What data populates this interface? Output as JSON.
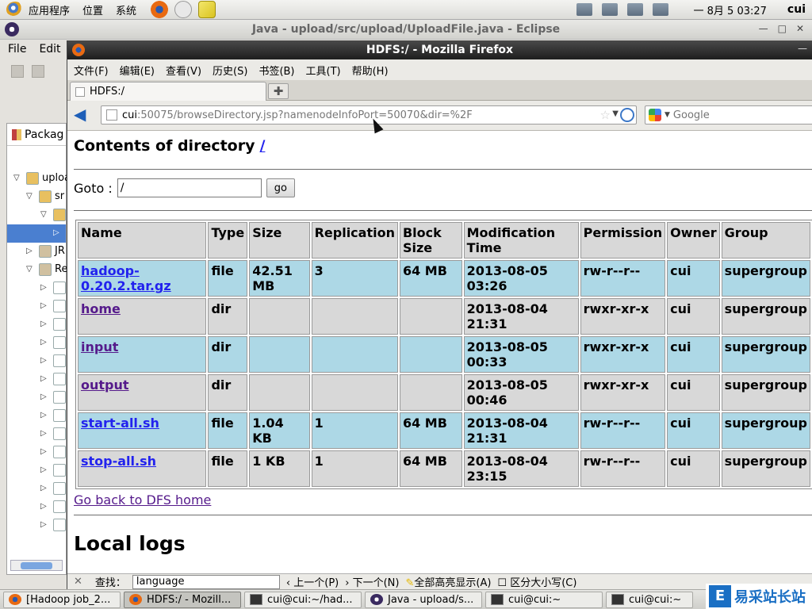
{
  "top_panel": {
    "menus": [
      "应用程序",
      "位置",
      "系统"
    ],
    "clock": "一 8月  5 03:27",
    "user": "cui"
  },
  "eclipse": {
    "title": "Java - upload/src/upload/UploadFile.java - Eclipse",
    "menu": [
      "File",
      "Edit"
    ],
    "package_view_label": "Packag",
    "tree": [
      "uploa",
      "sr",
      "",
      "",
      "JR",
      "Re"
    ]
  },
  "firefox": {
    "title": "HDFS:/ - Mozilla Firefox",
    "menu": [
      "文件(F)",
      "编辑(E)",
      "查看(V)",
      "历史(S)",
      "书签(B)",
      "工具(T)",
      "帮助(H)"
    ],
    "tab_label": "HDFS:/",
    "url_host": "cui",
    "url_path": ":50075/browseDirectory.jsp?namenodeInfoPort=50070&dir=%2F",
    "search_placeholder": "Google"
  },
  "page": {
    "heading": "Contents of directory",
    "heading_link": "/",
    "goto_label": "Goto :",
    "goto_value": "/",
    "go_button": "go",
    "table": {
      "headers": [
        "Name",
        "Type",
        "Size",
        "Replication",
        "Block Size",
        "Modification Time",
        "Permission",
        "Owner",
        "Group"
      ],
      "rows": [
        [
          "hadoop-0.20.2.tar.gz",
          "file",
          "42.51 MB",
          "3",
          "64 MB",
          "2013-08-05 03:26",
          "rw-r--r--",
          "cui",
          "supergroup"
        ],
        [
          "home",
          "dir",
          "",
          "",
          "",
          "2013-08-04 21:31",
          "rwxr-xr-x",
          "cui",
          "supergroup"
        ],
        [
          "input",
          "dir",
          "",
          "",
          "",
          "2013-08-05 00:33",
          "rwxr-xr-x",
          "cui",
          "supergroup"
        ],
        [
          "output",
          "dir",
          "",
          "",
          "",
          "2013-08-05 00:46",
          "rwxr-xr-x",
          "cui",
          "supergroup"
        ],
        [
          "start-all.sh",
          "file",
          "1.04 KB",
          "1",
          "64 MB",
          "2013-08-04 21:31",
          "rw-r--r--",
          "cui",
          "supergroup"
        ],
        [
          "stop-all.sh",
          "file",
          "1 KB",
          "1",
          "64 MB",
          "2013-08-04 23:15",
          "rw-r--r--",
          "cui",
          "supergroup"
        ]
      ]
    },
    "back_link": "Go back to DFS home",
    "logs_heading": "Local logs"
  },
  "findbar": {
    "label": "查找：",
    "value": "language",
    "prev": "上一个(P)",
    "next": "下一个(N)",
    "highlight": "全部高亮显示(A)",
    "match_case": "区分大小写(C)"
  },
  "taskbar": [
    "[Hadoop job_2...",
    "HDFS:/ - Mozill...",
    "cui@cui:~/had...",
    "Java - upload/s...",
    "cui@cui:~",
    "cui@cui:~"
  ],
  "watermark": "易采站长站"
}
